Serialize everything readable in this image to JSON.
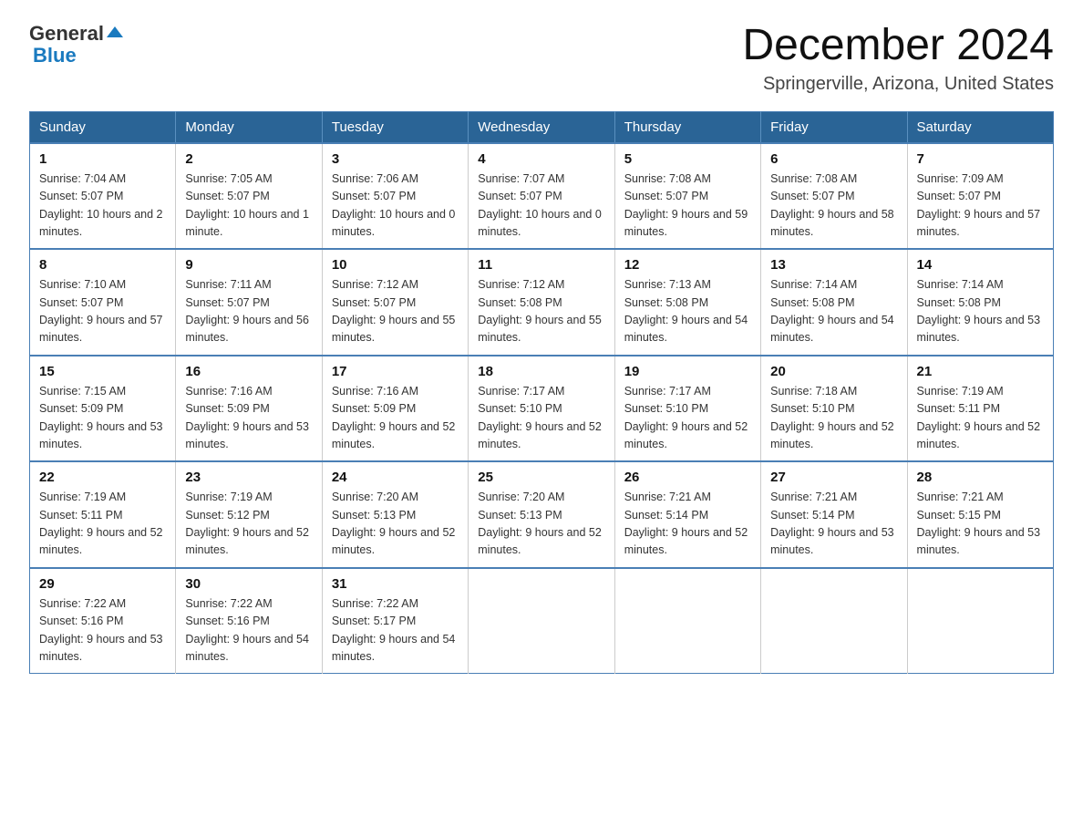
{
  "logo": {
    "general": "General",
    "blue": "Blue",
    "arrow": "▼"
  },
  "header": {
    "month_year": "December 2024",
    "location": "Springerville, Arizona, United States"
  },
  "weekdays": [
    "Sunday",
    "Monday",
    "Tuesday",
    "Wednesday",
    "Thursday",
    "Friday",
    "Saturday"
  ],
  "weeks": [
    [
      {
        "day": "1",
        "sunrise": "7:04 AM",
        "sunset": "5:07 PM",
        "daylight": "10 hours and 2 minutes."
      },
      {
        "day": "2",
        "sunrise": "7:05 AM",
        "sunset": "5:07 PM",
        "daylight": "10 hours and 1 minute."
      },
      {
        "day": "3",
        "sunrise": "7:06 AM",
        "sunset": "5:07 PM",
        "daylight": "10 hours and 0 minutes."
      },
      {
        "day": "4",
        "sunrise": "7:07 AM",
        "sunset": "5:07 PM",
        "daylight": "10 hours and 0 minutes."
      },
      {
        "day": "5",
        "sunrise": "7:08 AM",
        "sunset": "5:07 PM",
        "daylight": "9 hours and 59 minutes."
      },
      {
        "day": "6",
        "sunrise": "7:08 AM",
        "sunset": "5:07 PM",
        "daylight": "9 hours and 58 minutes."
      },
      {
        "day": "7",
        "sunrise": "7:09 AM",
        "sunset": "5:07 PM",
        "daylight": "9 hours and 57 minutes."
      }
    ],
    [
      {
        "day": "8",
        "sunrise": "7:10 AM",
        "sunset": "5:07 PM",
        "daylight": "9 hours and 57 minutes."
      },
      {
        "day": "9",
        "sunrise": "7:11 AM",
        "sunset": "5:07 PM",
        "daylight": "9 hours and 56 minutes."
      },
      {
        "day": "10",
        "sunrise": "7:12 AM",
        "sunset": "5:07 PM",
        "daylight": "9 hours and 55 minutes."
      },
      {
        "day": "11",
        "sunrise": "7:12 AM",
        "sunset": "5:08 PM",
        "daylight": "9 hours and 55 minutes."
      },
      {
        "day": "12",
        "sunrise": "7:13 AM",
        "sunset": "5:08 PM",
        "daylight": "9 hours and 54 minutes."
      },
      {
        "day": "13",
        "sunrise": "7:14 AM",
        "sunset": "5:08 PM",
        "daylight": "9 hours and 54 minutes."
      },
      {
        "day": "14",
        "sunrise": "7:14 AM",
        "sunset": "5:08 PM",
        "daylight": "9 hours and 53 minutes."
      }
    ],
    [
      {
        "day": "15",
        "sunrise": "7:15 AM",
        "sunset": "5:09 PM",
        "daylight": "9 hours and 53 minutes."
      },
      {
        "day": "16",
        "sunrise": "7:16 AM",
        "sunset": "5:09 PM",
        "daylight": "9 hours and 53 minutes."
      },
      {
        "day": "17",
        "sunrise": "7:16 AM",
        "sunset": "5:09 PM",
        "daylight": "9 hours and 52 minutes."
      },
      {
        "day": "18",
        "sunrise": "7:17 AM",
        "sunset": "5:10 PM",
        "daylight": "9 hours and 52 minutes."
      },
      {
        "day": "19",
        "sunrise": "7:17 AM",
        "sunset": "5:10 PM",
        "daylight": "9 hours and 52 minutes."
      },
      {
        "day": "20",
        "sunrise": "7:18 AM",
        "sunset": "5:10 PM",
        "daylight": "9 hours and 52 minutes."
      },
      {
        "day": "21",
        "sunrise": "7:19 AM",
        "sunset": "5:11 PM",
        "daylight": "9 hours and 52 minutes."
      }
    ],
    [
      {
        "day": "22",
        "sunrise": "7:19 AM",
        "sunset": "5:11 PM",
        "daylight": "9 hours and 52 minutes."
      },
      {
        "day": "23",
        "sunrise": "7:19 AM",
        "sunset": "5:12 PM",
        "daylight": "9 hours and 52 minutes."
      },
      {
        "day": "24",
        "sunrise": "7:20 AM",
        "sunset": "5:13 PM",
        "daylight": "9 hours and 52 minutes."
      },
      {
        "day": "25",
        "sunrise": "7:20 AM",
        "sunset": "5:13 PM",
        "daylight": "9 hours and 52 minutes."
      },
      {
        "day": "26",
        "sunrise": "7:21 AM",
        "sunset": "5:14 PM",
        "daylight": "9 hours and 52 minutes."
      },
      {
        "day": "27",
        "sunrise": "7:21 AM",
        "sunset": "5:14 PM",
        "daylight": "9 hours and 53 minutes."
      },
      {
        "day": "28",
        "sunrise": "7:21 AM",
        "sunset": "5:15 PM",
        "daylight": "9 hours and 53 minutes."
      }
    ],
    [
      {
        "day": "29",
        "sunrise": "7:22 AM",
        "sunset": "5:16 PM",
        "daylight": "9 hours and 53 minutes."
      },
      {
        "day": "30",
        "sunrise": "7:22 AM",
        "sunset": "5:16 PM",
        "daylight": "9 hours and 54 minutes."
      },
      {
        "day": "31",
        "sunrise": "7:22 AM",
        "sunset": "5:17 PM",
        "daylight": "9 hours and 54 minutes."
      },
      null,
      null,
      null,
      null
    ]
  ],
  "labels": {
    "sunrise": "Sunrise:",
    "sunset": "Sunset:",
    "daylight": "Daylight:"
  }
}
